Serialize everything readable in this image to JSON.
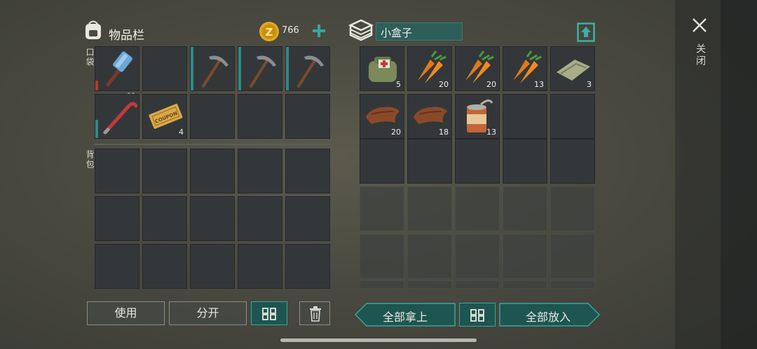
{
  "left_panel": {
    "title": "物品栏",
    "currency_amount": "766",
    "pocket_label": "口袋",
    "backpack_label": "背包",
    "pocket_slots": [
      {
        "item": "sledgehammer",
        "count": "",
        "durability_color": "#b83a2a"
      },
      {
        "item": "",
        "count": ""
      },
      {
        "item": "pickaxe",
        "count": "",
        "durability_color": "#2f8a86"
      },
      {
        "item": "pickaxe",
        "count": "",
        "durability_color": "#2f8a86"
      },
      {
        "item": "pickaxe",
        "count": "",
        "durability_color": "#2f8a86"
      },
      {
        "item": "crowbar",
        "count": "",
        "durability_color": "#2f8a86"
      },
      {
        "item": "coupon-ticket",
        "count": "4"
      },
      {
        "item": "",
        "count": ""
      },
      {
        "item": "",
        "count": ""
      },
      {
        "item": "",
        "count": ""
      }
    ]
  },
  "right_panel": {
    "container_name": "小盒子",
    "slots": [
      {
        "item": "first-aid-bag",
        "count": "5"
      },
      {
        "item": "carrots",
        "count": "20"
      },
      {
        "item": "carrots",
        "count": "20"
      },
      {
        "item": "carrots",
        "count": "13"
      },
      {
        "item": "cloth",
        "count": "3"
      },
      {
        "item": "leather",
        "count": "20"
      },
      {
        "item": "leather",
        "count": "18"
      },
      {
        "item": "canned-food",
        "count": "13"
      }
    ]
  },
  "buttons": {
    "use": "使用",
    "split": "分开",
    "take_all": "全部拿上",
    "put_all": "全部放入"
  },
  "close_label": "关闭",
  "colors": {
    "teal_accent": "#3aa59a",
    "coin_gold": "#e0a820"
  }
}
